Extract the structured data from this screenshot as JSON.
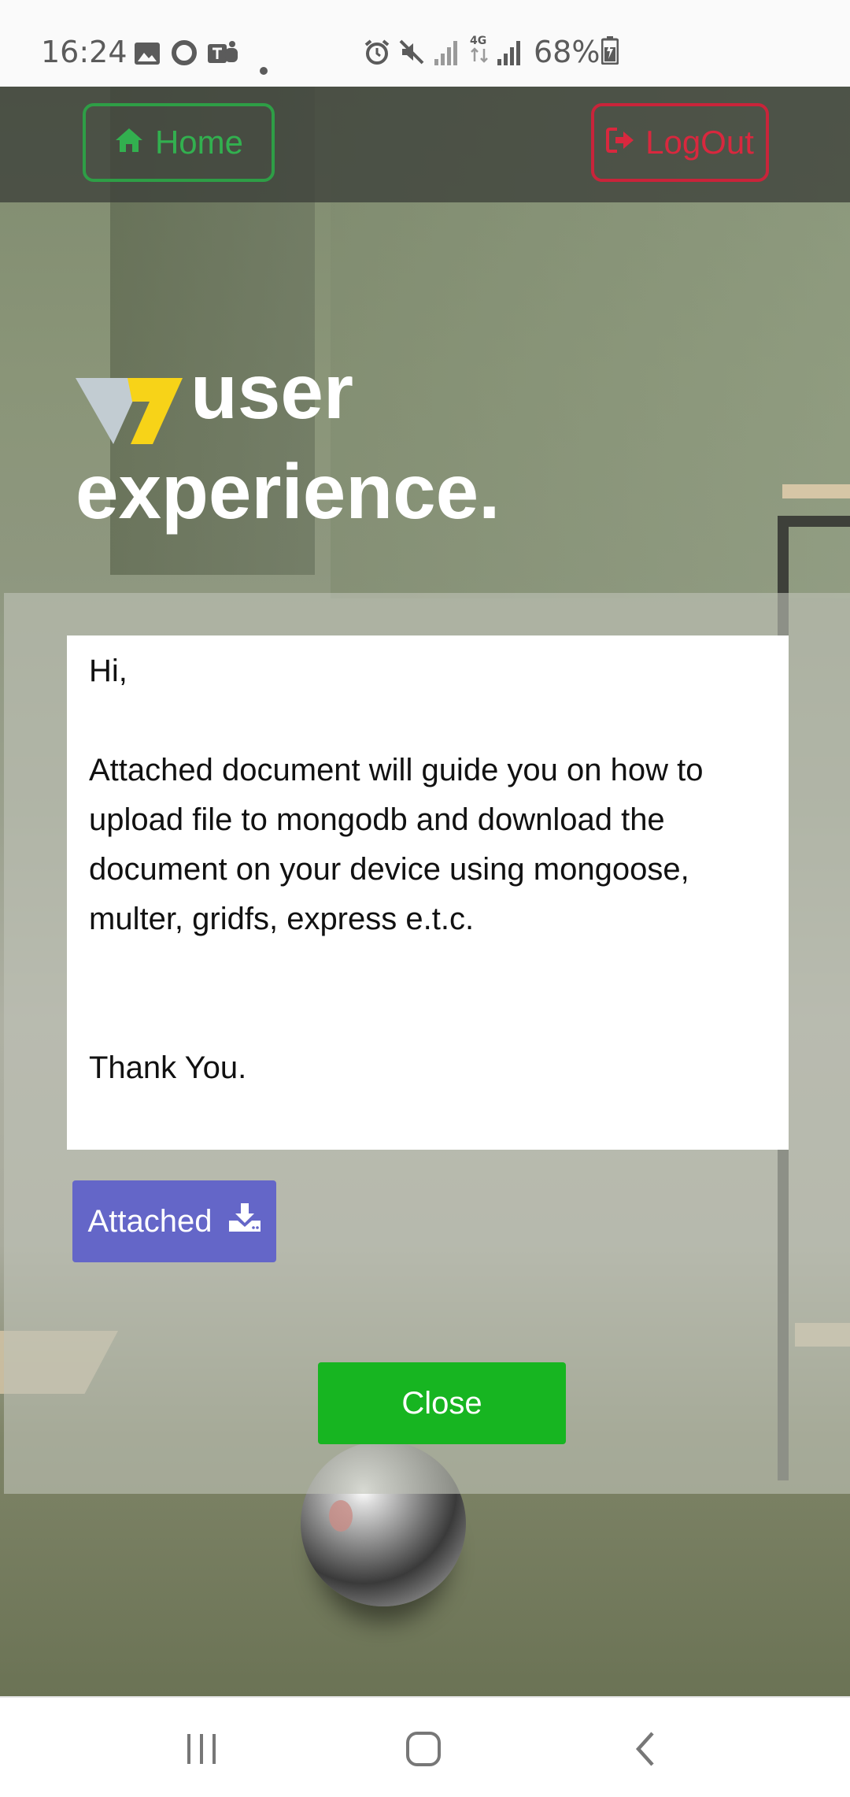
{
  "status_bar": {
    "time": "16:24",
    "battery": "68%",
    "icons": [
      "gallery-icon",
      "opera-icon",
      "teams-icon",
      "dot-icon",
      "alarm-icon",
      "mute-icon",
      "signal-icon",
      "4g-icon",
      "signal-icon",
      "battery-charging-icon"
    ]
  },
  "nav": {
    "home_label": "Home",
    "logout_label": "LogOut",
    "home_color": "#32b04f",
    "logout_color": "#d8283e"
  },
  "hero": {
    "line1": "user",
    "line2": "experience."
  },
  "message": {
    "greeting": "Hi,",
    "body": "Attached document will guide you on how to upload file to mongodb and download the document on your device using mongoose, multer, gridfs, express e.t.c.",
    "signoff": "Thank You."
  },
  "attachment": {
    "label": "Attached",
    "color": "#6466c8"
  },
  "close": {
    "label": "Close",
    "color": "#17b521"
  },
  "system_nav": {
    "recents": "recents-icon",
    "home": "home-icon",
    "back": "back-icon"
  }
}
